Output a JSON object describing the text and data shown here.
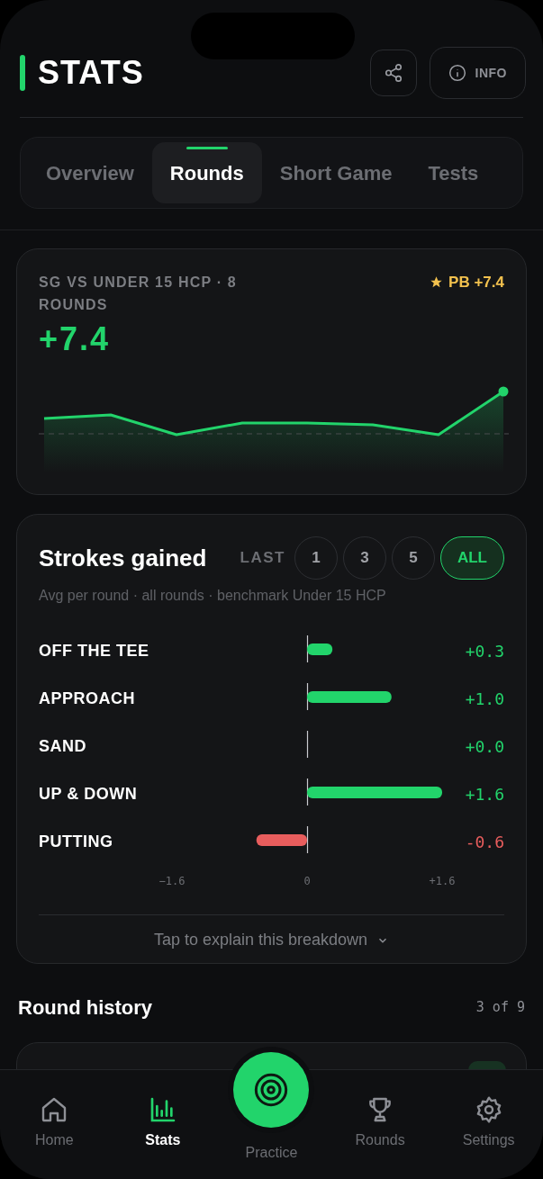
{
  "header": {
    "title": "STATS",
    "info_button": "INFO"
  },
  "tabs": [
    {
      "label": "Overview",
      "selected": false
    },
    {
      "label": "Rounds",
      "selected": true
    },
    {
      "label": "Short Game",
      "selected": false
    },
    {
      "label": "Tests",
      "selected": false
    }
  ],
  "trend_card": {
    "caption": "SG VS UNDER 15 HCP · 8 ROUNDS",
    "personal_best": "PB +7.4",
    "value": "+7.4"
  },
  "strokes_card": {
    "title": "Strokes gained",
    "filter_label": "LAST",
    "filters": [
      {
        "label": "1",
        "selected": false
      },
      {
        "label": "3",
        "selected": false
      },
      {
        "label": "5",
        "selected": false
      },
      {
        "label": "ALL",
        "selected": true
      }
    ],
    "subtitle": "Avg per round · all rounds · benchmark Under 15 HCP",
    "chart_data": {
      "type": "bar",
      "orientation": "horizontal",
      "categories": [
        "OFF THE TEE",
        "APPROACH",
        "SAND",
        "UP & DOWN",
        "PUTTING"
      ],
      "ref_lines": [
        {
          "axis": "x",
          "value": 0,
          "color": "#c9cbcf"
        }
      ],
      "series": [
        {
          "color": "#22d46b",
          "values": [
            0.3,
            1.0,
            0.0,
            1.6,
            null
          ]
        },
        {
          "color": "#e85d5d",
          "values": [
            null,
            null,
            null,
            null,
            -0.6
          ]
        }
      ],
      "value_labels": [
        "+0.3",
        "+1.0",
        "+0.0",
        "+1.6",
        "-0.6"
      ],
      "xlim": [
        -1.6,
        1.6
      ],
      "xticks": [
        {
          "value": -1.6,
          "label": "−1.6"
        },
        {
          "value": 0,
          "label": "0"
        },
        {
          "value": 1.6,
          "label": "+1.6"
        }
      ]
    },
    "explain_link": "Tap to explain this breakdown"
  },
  "round_history": {
    "title": "Round history",
    "count": "3 of 9"
  },
  "nav": [
    {
      "label": "Home",
      "kind": "home",
      "selected": false
    },
    {
      "label": "Stats",
      "kind": "stats",
      "selected": true
    },
    {
      "label": "Practice",
      "kind": "practice",
      "selected": false
    },
    {
      "label": "Rounds",
      "kind": "rounds",
      "selected": false
    },
    {
      "label": "Settings",
      "kind": "settings",
      "selected": false
    }
  ]
}
